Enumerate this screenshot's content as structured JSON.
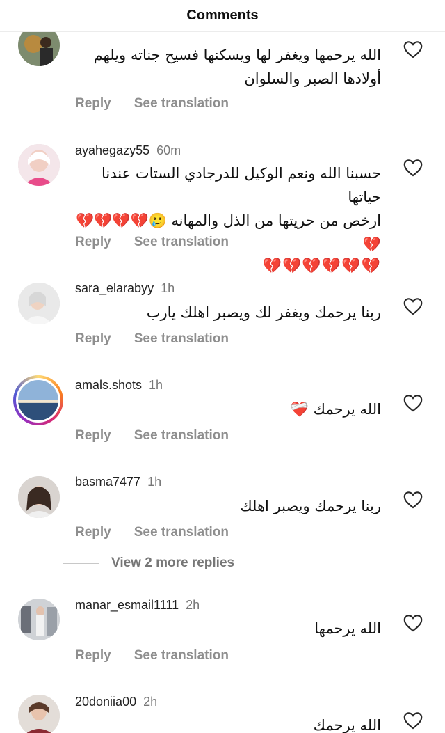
{
  "header": {
    "title": "Comments"
  },
  "actions": {
    "reply": "Reply",
    "translate": "See translation"
  },
  "view_more": "View 2 more replies",
  "comments": [
    {
      "username": "",
      "time": "",
      "lines": [
        "الله يرحمها ويغفر لها ويسكنها فسيح جناته ويلهم",
        "أولادها الصبر والسلوان"
      ]
    },
    {
      "username": "ayahegazy55",
      "time": "60m",
      "lines": [
        "حسبنا الله ونعم الوكيل للدرجادي الستات عندنا حياتها",
        "ارخص من حريتها من الذل والمهانه 🥲💔💔💔💔💔"
      ],
      "hearts": "💔💔💔💔💔💔"
    },
    {
      "username": "sara_elarabyy",
      "time": "1h",
      "lines": [
        "ربنا يرحمك ويغفر لك ويصبر اهلك يارب"
      ]
    },
    {
      "username": "amals.shots",
      "time": "1h",
      "lines": [
        "الله يرحمك ❤️‍🩹"
      ]
    },
    {
      "username": "basma7477",
      "time": "1h",
      "lines": [
        "ربنا يرحمك ويصبر اهلك"
      ]
    },
    {
      "username": "manar_esmail1111",
      "time": "2h",
      "lines": [
        "الله يرحمها"
      ]
    },
    {
      "username": "20doniia00",
      "time": "2h",
      "lines": [
        "الله يرحمك"
      ]
    }
  ]
}
